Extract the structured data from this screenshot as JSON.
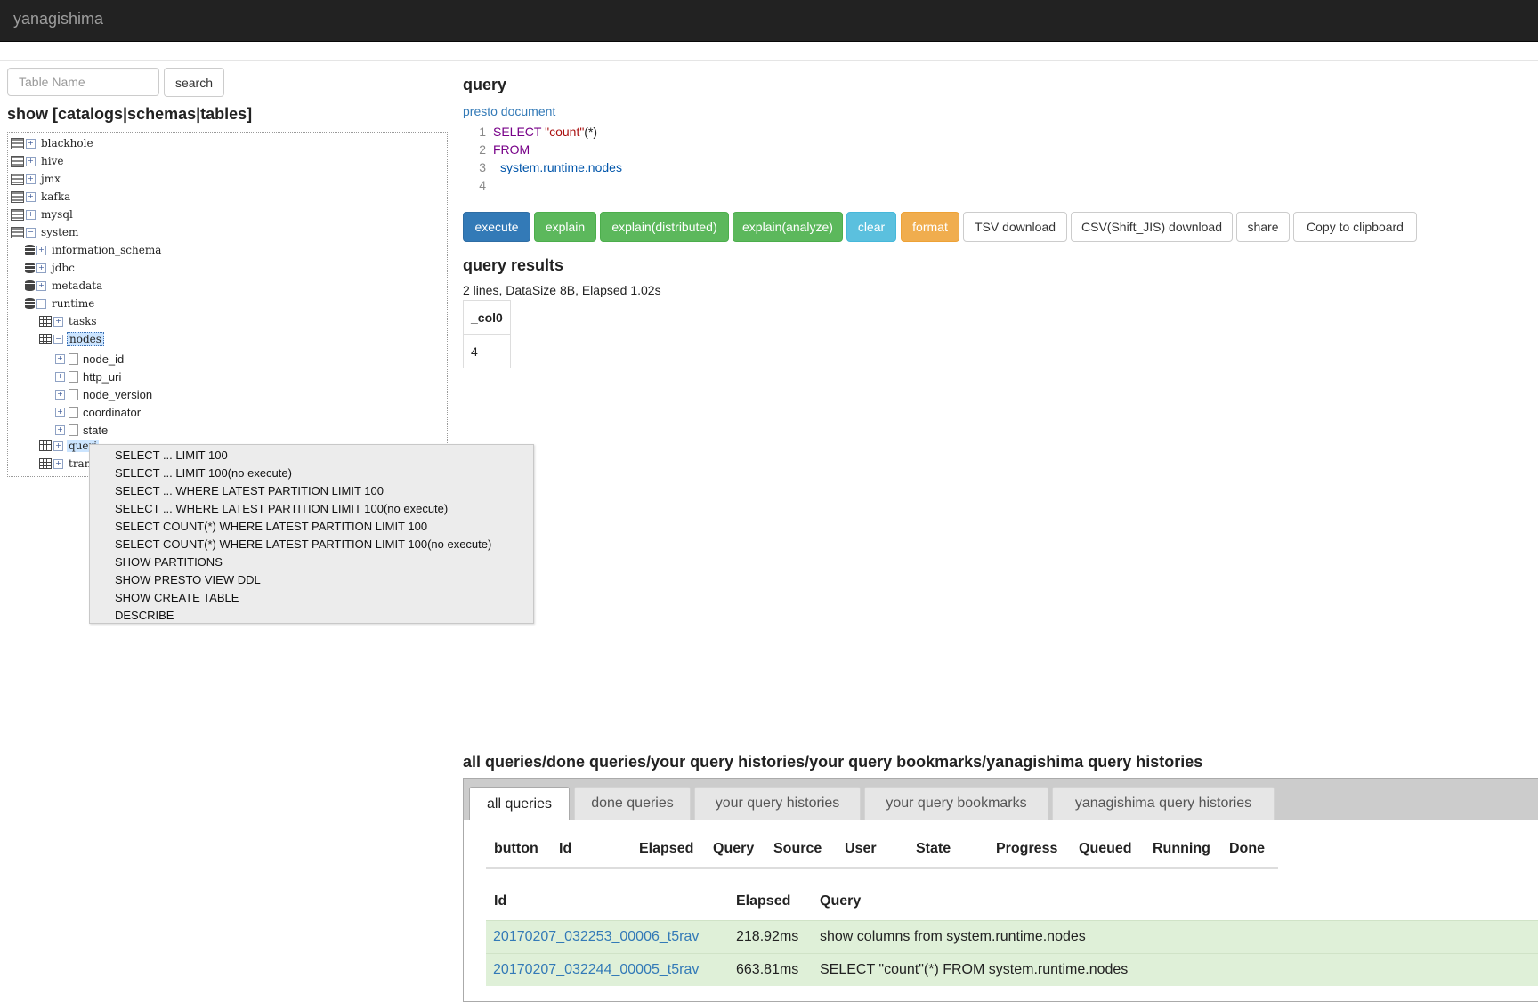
{
  "app": {
    "brand": "yanagishima"
  },
  "sidebar": {
    "search_placeholder": "Table Name",
    "search_button": "search",
    "heading": "show [catalogs|schemas|tables]",
    "tree": {
      "catalogs": [
        "blackhole",
        "hive",
        "jmx",
        "kafka",
        "mysql",
        "system"
      ],
      "schemas": [
        "information_schema",
        "jdbc",
        "metadata",
        "runtime"
      ],
      "tables": [
        "tasks",
        "nodes",
        "queri",
        "tran"
      ],
      "columns": [
        "node_id",
        "http_uri",
        "node_version",
        "coordinator",
        "state"
      ]
    },
    "context_menu": [
      "SELECT ... LIMIT 100",
      "SELECT ... LIMIT 100(no execute)",
      "SELECT ... WHERE LATEST PARTITION LIMIT 100",
      "SELECT ... WHERE LATEST PARTITION LIMIT 100(no execute)",
      "SELECT COUNT(*) WHERE LATEST PARTITION LIMIT 100",
      "SELECT COUNT(*) WHERE LATEST PARTITION LIMIT 100(no execute)",
      "SHOW PARTITIONS",
      "SHOW PRESTO VIEW DDL",
      "SHOW CREATE TABLE",
      "DESCRIBE"
    ]
  },
  "query": {
    "title": "query",
    "doc_link": "presto document",
    "lines": [
      "1",
      "2",
      "3",
      "4"
    ],
    "code": {
      "l1_kw": "SELECT",
      "l1_str": "\"count\"",
      "l1_rest": "(*)",
      "l2_kw": "FROM",
      "l3_var": "system.runtime.nodes"
    }
  },
  "toolbar": {
    "execute": "execute",
    "explain": "explain",
    "explain_distributed": "explain(distributed)",
    "explain_analyze": "explain(analyze)",
    "clear": "clear",
    "format": "format",
    "tsv": "TSV download",
    "csv": "CSV(Shift_JIS) download",
    "share": "share",
    "copy": "Copy to clipboard"
  },
  "results": {
    "title": "query results",
    "meta": "2 lines, DataSize 8B, Elapsed 1.02s",
    "column": "_col0",
    "value": "4"
  },
  "history": {
    "title": "all queries/done queries/your query histories/your query bookmarks/yanagishima query histories",
    "tabs": [
      "all queries",
      "done queries",
      "your query histories",
      "your query bookmarks",
      "yanagishima query histories"
    ],
    "columns": [
      "button",
      "Id",
      "Elapsed",
      "Query",
      "Source",
      "User",
      "State",
      "Progress",
      "Queued",
      "Running",
      "Done"
    ],
    "columns2": [
      "Id",
      "Elapsed",
      "Query"
    ],
    "rows": [
      {
        "id": "20170207_032253_00006_t5rav",
        "elapsed": "218.92ms",
        "query": "show columns from system.runtime.nodes"
      },
      {
        "id": "20170207_032244_00005_t5rav",
        "elapsed": "663.81ms",
        "query": "SELECT \"count\"(*) FROM system.runtime.nodes"
      }
    ]
  }
}
